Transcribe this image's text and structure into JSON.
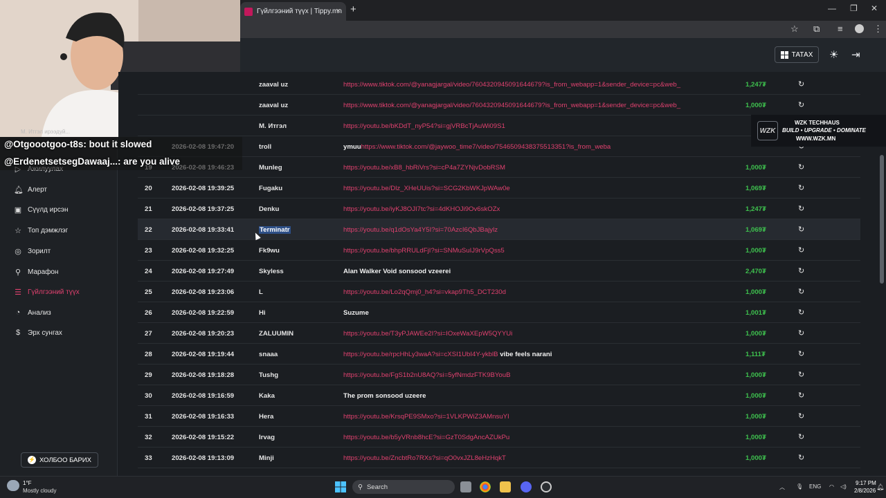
{
  "browser": {
    "tab_title": "Гүйлгээний түүх | Tippy.mn",
    "new_tab": "+",
    "tab_close": "×",
    "minimize": "—",
    "restore": "❐",
    "close": "✕"
  },
  "header": {
    "download_label": "ТАТАХ"
  },
  "sidebar": {
    "items": [
      {
        "label": "Ажилуулах",
        "icon": "play-icon"
      },
      {
        "label": "Алерт",
        "icon": "bell-icon"
      },
      {
        "label": "Сүүлд ирсэн",
        "icon": "bag-icon"
      },
      {
        "label": "Топ дэмжлэг",
        "icon": "star-icon"
      },
      {
        "label": "Зорилт",
        "icon": "target-icon"
      },
      {
        "label": "Марафон",
        "icon": "runner-icon"
      },
      {
        "label": "Гүйлгээний түүх",
        "icon": "list-icon",
        "active": true
      },
      {
        "label": "Анализ",
        "icon": "chart-icon"
      },
      {
        "label": "Эрх сунгах",
        "icon": "dollar-icon"
      }
    ],
    "contact_label": "ХОЛБОО БАРИХ"
  },
  "transactions": [
    {
      "no": "",
      "date": "",
      "name": "zaaval uz",
      "prefix": "",
      "link": "https://www.tiktok.com/@yanagjargal/video/7604320945091644679?is_from_webapp=1&sender_device=pc&web_",
      "suffix": "",
      "amount": "1,247₮"
    },
    {
      "no": "",
      "date": "",
      "name": "zaaval uz",
      "prefix": "",
      "link": "https://www.tiktok.com/@yanagjargal/video/7604320945091644679?is_from_webapp=1&sender_device=pc&web_",
      "suffix": "",
      "amount": "1,000₮"
    },
    {
      "no": "",
      "date": "",
      "name": "M. Итгэл",
      "prefix": "",
      "link": "https://youtu.be/bKDdT_nyP54?si=gjVRBcTjAuWi09S1",
      "suffix": "",
      "amount": ""
    },
    {
      "no": "",
      "date": "2026-02-08 19:47:20",
      "name": "troll",
      "prefix": "ymuu",
      "link": "https://www.tiktok.com/@jaywoo_time7/video/7546509438375513351?is_from_weba",
      "suffix": "",
      "amount": ""
    },
    {
      "no": "19",
      "date": "2026-02-08 19:46:23",
      "name": "Munleg",
      "prefix": "",
      "link": "https://youtu.be/xB8_hbRiVrs?si=cP4a7ZYNjvDobRSM",
      "suffix": "",
      "amount": "1,000₮"
    },
    {
      "no": "20",
      "date": "2026-02-08 19:39:25",
      "name": "Fugaku",
      "prefix": "",
      "link": "https://youtu.be/Dlz_XHeUUis?si=SCG2KbWKJpWAw0e",
      "suffix": "",
      "amount": "1,069₮"
    },
    {
      "no": "21",
      "date": "2026-02-08 19:37:25",
      "name": "Denku",
      "prefix": "",
      "link": "https://youtu.be/iyKJ8OJI7tc?si=4dKHOJi9Ov6skOZx",
      "suffix": "",
      "amount": "1,247₮"
    },
    {
      "no": "22",
      "date": "2026-02-08 19:33:41",
      "name": "Terminatr",
      "prefix": "",
      "link": "https://youtu.be/q1dOsYa4Y5I?si=70AzcI6QbJBajylz",
      "suffix": "",
      "amount": "1,069₮",
      "highlight": true
    },
    {
      "no": "23",
      "date": "2026-02-08 19:32:25",
      "name": "Fk9wu",
      "prefix": "",
      "link": "https://youtu.be/bhpRRULdFjI?si=SNMuSuIJ9rVpQss5",
      "suffix": "",
      "amount": "1,000₮"
    },
    {
      "no": "24",
      "date": "2026-02-08 19:27:49",
      "name": "Skyless",
      "prefix": "Alan Walker Void sonsood vzeerei",
      "link": "",
      "suffix": "",
      "amount": "2,470₮"
    },
    {
      "no": "25",
      "date": "2026-02-08 19:23:06",
      "name": "L",
      "prefix": "",
      "link": "https://youtu.be/Lo2qQmj0_h4?si=vkap9Th5_DCT230d",
      "suffix": "",
      "amount": "1,000₮"
    },
    {
      "no": "26",
      "date": "2026-02-08 19:22:59",
      "name": "Hi",
      "prefix": "Suzume",
      "link": "",
      "suffix": "",
      "amount": "1,001₮"
    },
    {
      "no": "27",
      "date": "2026-02-08 19:20:23",
      "name": "ZALUUMIN",
      "prefix": "",
      "link": "https://youtu.be/T3yPJAWEe2I?si=IOxeWaXEpW5QYYUi",
      "suffix": "",
      "amount": "1,000₮"
    },
    {
      "no": "28",
      "date": "2026-02-08 19:19:44",
      "name": "snaaa",
      "prefix": "",
      "link": "https://youtu.be/rpcHhLy3waA?si=cXSI1UbI4Y-ykblB",
      "suffix": " vibe feels narani",
      "amount": "1,111₮"
    },
    {
      "no": "29",
      "date": "2026-02-08 19:18:28",
      "name": "Tushg",
      "prefix": "",
      "link": "https://youtu.be/FgS1b2nU8AQ?si=5yfNmdzFTK9BYouB",
      "suffix": "",
      "amount": "1,000₮"
    },
    {
      "no": "30",
      "date": "2026-02-08 19:16:59",
      "name": "Kaka",
      "prefix": "The prom sonsood uzeere",
      "link": "",
      "suffix": "",
      "amount": "1,000₮"
    },
    {
      "no": "31",
      "date": "2026-02-08 19:16:33",
      "name": "Hera",
      "prefix": "",
      "link": "https://youtu.be/KrsqPE9SMxo?si=1VLKPWiZ3AMnsuYI",
      "suffix": "",
      "amount": "1,000₮"
    },
    {
      "no": "32",
      "date": "2026-02-08 19:15:22",
      "name": "Irvag",
      "prefix": "",
      "link": "https://youtu.be/b5yVRnb8hcE?si=GzT0SdgAncAZUkPu",
      "suffix": "",
      "amount": "1,000₮"
    },
    {
      "no": "33",
      "date": "2026-02-08 19:13:09",
      "name": "Minji",
      "prefix": "",
      "link": "https://youtu.be/ZncbtRo7RXs?si=qO0vxJZL8eHzHqkT",
      "suffix": "",
      "amount": "1,000₮"
    }
  ],
  "chat": [
    {
      "user": "@Otgoootgoo-t8s",
      "message": ": bout it slowed"
    },
    {
      "user": "@ErdenetsetsegDawaaj...",
      "message": ": are you alive"
    }
  ],
  "chat_faded": "M. Итгэл ирээдүй...",
  "overlay": {
    "line1": "WZK TECHHAUS",
    "line2": "BUILD • UPGRADE • DOMINATE",
    "line3": "WWW.WZK.MN",
    "logo": "WZK"
  },
  "taskbar": {
    "weather_temp": "1°F",
    "weather_desc": "Mostly cloudy",
    "search_label": "Search",
    "language": "ENG",
    "time": "9:17 PM",
    "date": "2/8/2026"
  },
  "colors": {
    "accent": "#e0416f",
    "amount": "#3ec14e",
    "background": "#1b1e22"
  }
}
